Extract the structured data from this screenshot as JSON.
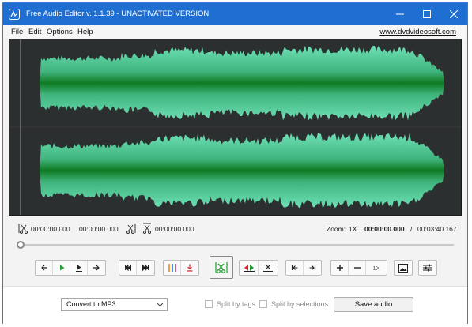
{
  "window": {
    "title": "Free Audio Editor v. 1.1.39 - UNACTIVATED VERSION"
  },
  "menu": {
    "file": "File",
    "edit": "Edit",
    "options": "Options",
    "help": "Help",
    "site": "www.dvdvideosoft.com"
  },
  "times": {
    "selection_start": "00:00:00.000",
    "selection_end": "00:00:00.000",
    "cut_time": "00:00:00.000",
    "zoom_label": "Zoom:",
    "zoom_value": "1X",
    "position": "00:00:00.000",
    "separator": "/",
    "duration": "00:03:40.167"
  },
  "playback": {
    "position_fraction": 0
  },
  "toolbar": {
    "zoom_reset": "1X"
  },
  "output": {
    "format": "Convert to MP3",
    "split_by_tags": "Split by tags",
    "split_by_selections": "Split by selections",
    "split_by_tags_checked": false,
    "split_by_selections_checked": false,
    "save_label": "Save audio"
  },
  "colors": {
    "titlebar": "#1f6fd2",
    "waveform_bg": "#2c2f2f",
    "wave_fill": "#5fd3a6",
    "wave_core": "#0e7a22"
  }
}
